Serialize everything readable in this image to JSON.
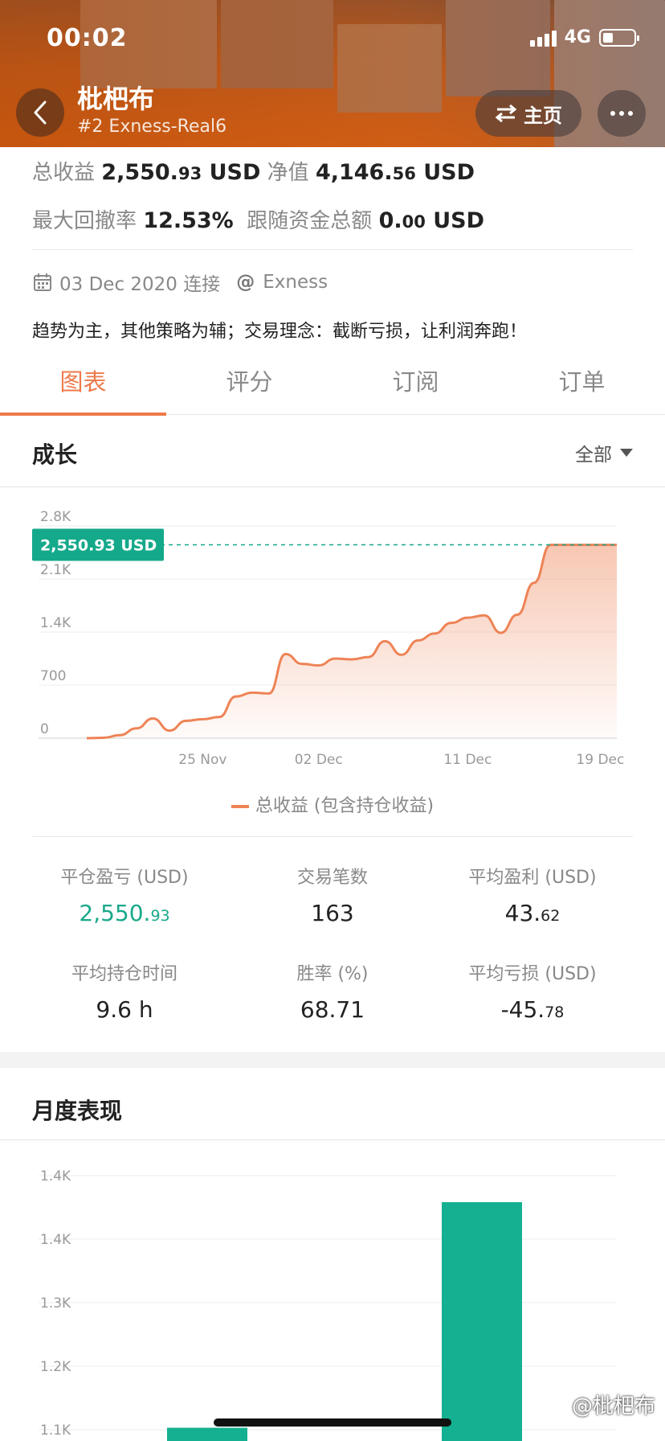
{
  "status_bar": {
    "time": "00:02",
    "network": "4G"
  },
  "header": {
    "title": "枇杷布",
    "subtitle": "#2 Exness-Real6",
    "home_label": "主页"
  },
  "summary": {
    "total_profit_label": "总收益",
    "total_profit_main": "2,550.",
    "total_profit_dec": "93",
    "total_profit_unit": "USD",
    "equity_label": "净值",
    "equity_main": "4,146.",
    "equity_dec": "56",
    "equity_unit": "USD",
    "drawdown_label": "最大回撤率",
    "drawdown_value": "12.53%",
    "follow_label": "跟随资金总额",
    "follow_main": "0.",
    "follow_dec": "00",
    "follow_unit": "USD"
  },
  "meta": {
    "date": "03 Dec 2020 连接",
    "broker_symbol": "@",
    "broker": "Exness"
  },
  "description": "趋势为主，其他策略为辅；交易理念：截断亏损，让利润奔跑！",
  "tabs": [
    {
      "label": "图表",
      "active": true
    },
    {
      "label": "评分",
      "active": false
    },
    {
      "label": "订阅",
      "active": false
    },
    {
      "label": "订单",
      "active": false
    }
  ],
  "growth": {
    "section_title": "成长",
    "filter_label": "全部",
    "legend": "总收益 (包含持仓收益)",
    "current_label": "2,550.93 USD",
    "accent_color": "#ee8356",
    "marker_color": "#14a98a"
  },
  "chart_data": [
    {
      "type": "area",
      "title": "成长",
      "series": [
        {
          "name": "总收益 (包含持仓收益)",
          "x": [
            "2020-11-18",
            "2020-11-19",
            "2020-11-20",
            "2020-11-21",
            "2020-11-22",
            "2020-11-23",
            "2020-11-24",
            "2020-11-25",
            "2020-11-26",
            "2020-11-27",
            "2020-11-28",
            "2020-11-29",
            "2020-11-30",
            "2020-12-01",
            "2020-12-02",
            "2020-12-03",
            "2020-12-04",
            "2020-12-05",
            "2020-12-06",
            "2020-12-07",
            "2020-12-08",
            "2020-12-09",
            "2020-12-10",
            "2020-12-11",
            "2020-12-12",
            "2020-12-13",
            "2020-12-14",
            "2020-12-15",
            "2020-12-16",
            "2020-12-17",
            "2020-12-18",
            "2020-12-19",
            "2020-12-20"
          ],
          "values": [
            0,
            5,
            40,
            130,
            260,
            100,
            230,
            250,
            280,
            550,
            600,
            590,
            1110,
            980,
            960,
            1050,
            1040,
            1070,
            1280,
            1100,
            1290,
            1380,
            1520,
            1590,
            1620,
            1390,
            1630,
            2050,
            2550,
            2550,
            2550,
            2550,
            2550
          ]
        }
      ],
      "x_tick_labels": [
        "25 Nov",
        "02 Dec",
        "11 Dec",
        "19 Dec"
      ],
      "y_tick_labels": [
        "0",
        "700",
        "1.4K",
        "2.1K",
        "2.8K"
      ],
      "ylim": [
        0,
        2800
      ],
      "grid": true,
      "annotation": "2,550.93 USD"
    },
    {
      "type": "bar",
      "title": "月度表现",
      "categories": [
        "",
        ""
      ],
      "values": [
        1.12,
        1.46
      ],
      "y_tick_labels": [
        "1.1K",
        "1.2K",
        "1.3K",
        "1.4K",
        "1.4K"
      ],
      "ylim": [
        1.1,
        1.5
      ],
      "grid": true,
      "color": "#14b091"
    }
  ],
  "stats": [
    {
      "label": "平仓盈亏 (USD)",
      "main": "2,550.",
      "dec": "93",
      "green": true
    },
    {
      "label": "交易笔数",
      "main": "163",
      "dec": "",
      "green": false
    },
    {
      "label": "平均盈利 (USD)",
      "main": "43.",
      "dec": "62",
      "green": false
    },
    {
      "label": "平均持仓时间",
      "main": "9.6 h",
      "dec": "",
      "green": false
    },
    {
      "label": "胜率 (%)",
      "main": "68.71",
      "dec": "",
      "green": false
    },
    {
      "label": "平均亏损 (USD)",
      "main": "-45.",
      "dec": "78",
      "green": false
    }
  ],
  "monthly": {
    "section_title": "月度表现"
  },
  "watermark": "@枇杷布"
}
